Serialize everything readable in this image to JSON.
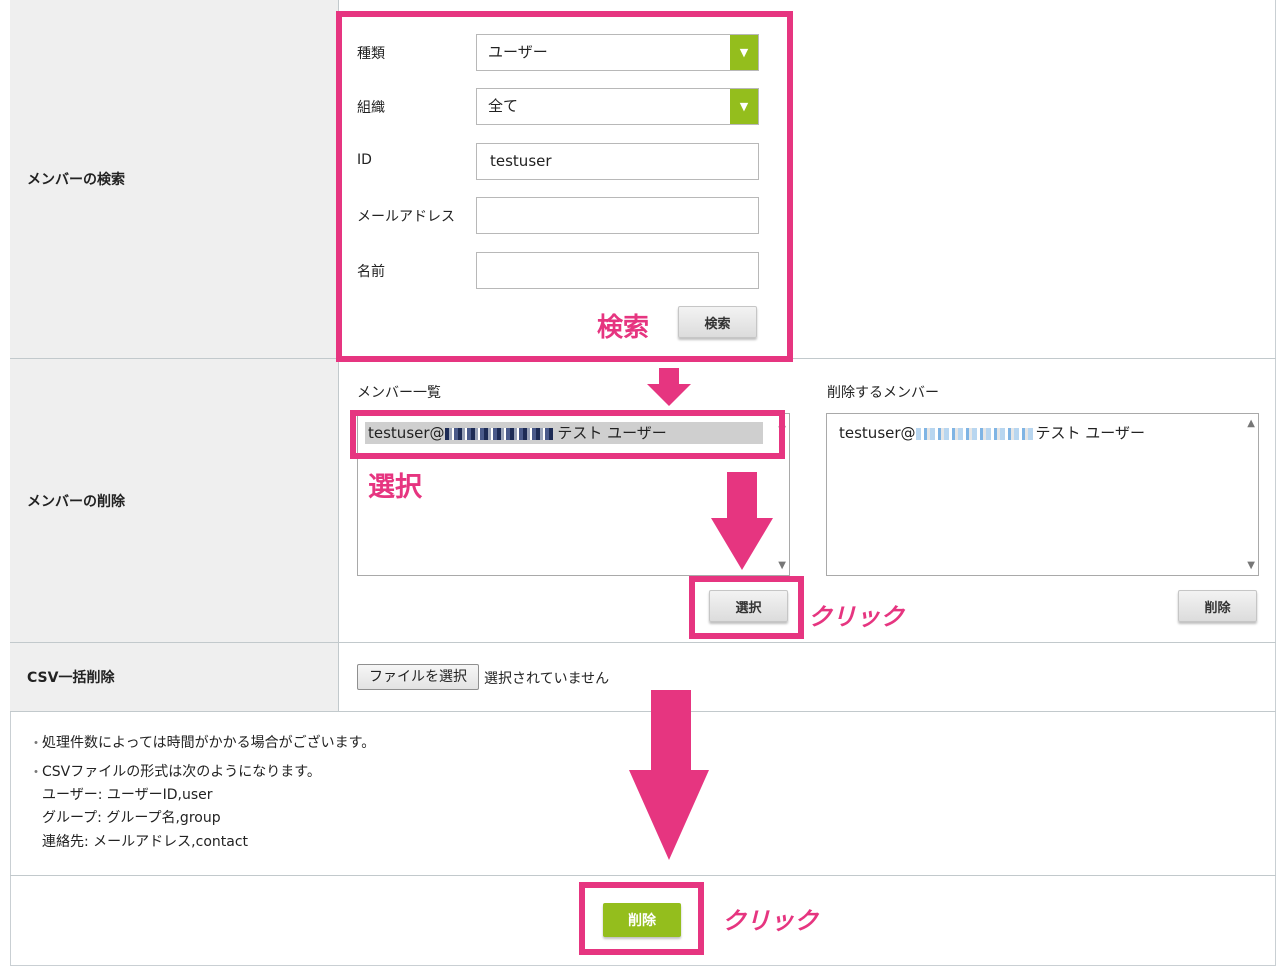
{
  "sections": {
    "search": {
      "label": "メンバーの検索",
      "type_label": "種類",
      "type_value": "ユーザー",
      "org_label": "組織",
      "org_value": "全て",
      "id_label": "ID",
      "id_value": "testuser",
      "email_label": "メールアドレス",
      "email_value": "",
      "name_label": "名前",
      "name_value": "",
      "search_button": "検索"
    },
    "delete": {
      "label": "メンバーの削除",
      "member_list_label": "メンバー一覧",
      "member_item_prefix": "testuser@",
      "member_item_suffix": "テスト ユーザー",
      "delete_list_label": "削除するメンバー",
      "delete_item_prefix": "testuser@",
      "delete_item_suffix": "テスト ユーザー",
      "select_button": "選択",
      "remove_button": "削除"
    },
    "csv": {
      "label": "CSV一括削除",
      "file_button": "ファイルを選択",
      "file_status": "選択されていません"
    }
  },
  "notes": {
    "note1": "処理件数によっては時間がかかる場合がございます。",
    "note2": "CSVファイルの形式は次のようになります。",
    "format_user": "ユーザー: ユーザーID,user",
    "format_group": "グループ: グループ名,group",
    "format_contact": "連絡先: メールアドレス,contact"
  },
  "footer": {
    "delete_button": "削除"
  },
  "annotations": {
    "search": "検索",
    "select": "選択",
    "click1": "クリック",
    "click2": "クリック"
  },
  "colors": {
    "accent_green": "#94be1d",
    "annotation_pink": "#e63580",
    "label_bg": "#efefef"
  }
}
